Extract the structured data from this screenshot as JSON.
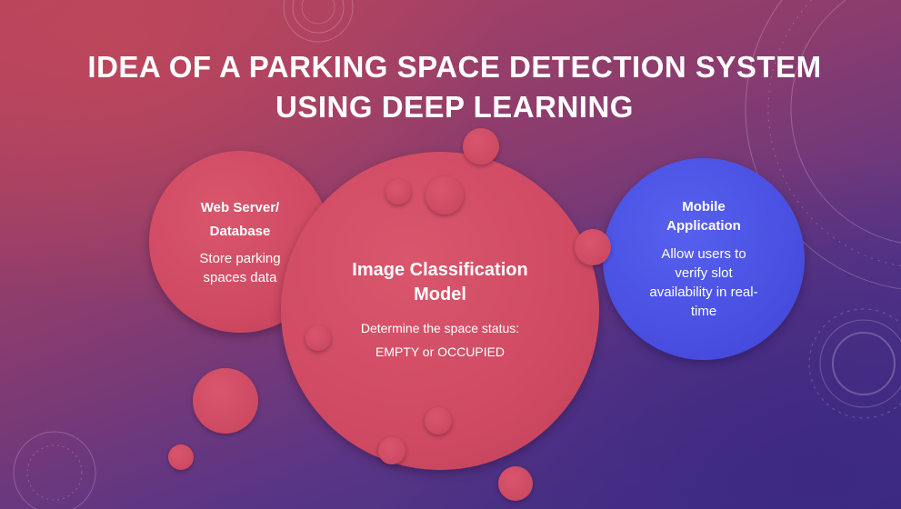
{
  "slide": {
    "title_line1": "IDEA OF A PARKING SPACE DETECTION SYSTEM",
    "title_line2": "USING DEEP LEARNING"
  },
  "web_server": {
    "heading_line1": "Web Server/",
    "heading_line2": "Database",
    "text_line1": "Store parking",
    "text_line2": "spaces data"
  },
  "image_model": {
    "heading_line1": "Image Classification",
    "heading_line2": "Model",
    "text_line1": "Determine the space status:",
    "text_line2": "EMPTY or OCCUPIED"
  },
  "mobile_app": {
    "heading_line1": "Mobile",
    "heading_line2": "Application",
    "text_line1": "Allow users to",
    "text_line2": "verify slot",
    "text_line3": "availability in real-",
    "text_line4": "time"
  },
  "colors": {
    "pink_circle": "#cf4a62",
    "blue_circle": "#4a50e2",
    "text": "#ffffff"
  }
}
